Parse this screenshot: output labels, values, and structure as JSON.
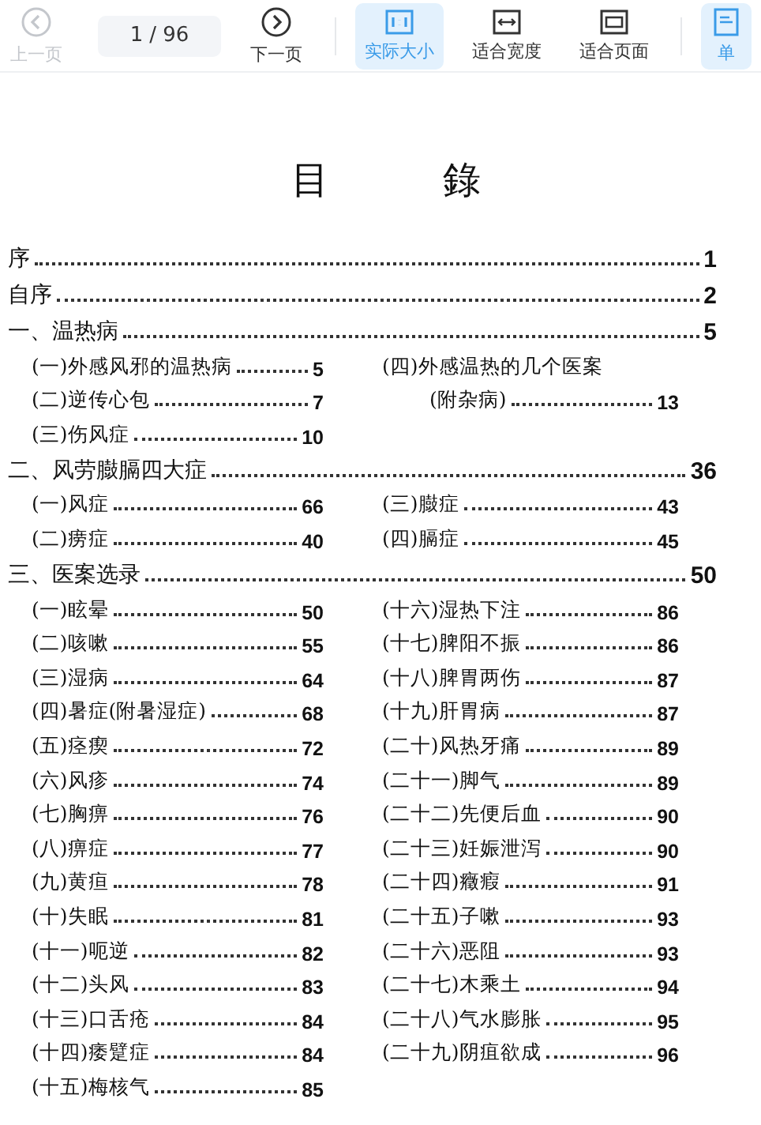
{
  "toolbar": {
    "items": [
      {
        "kind": "prev",
        "label": "上一页",
        "disabled": true,
        "selected": false
      },
      {
        "kind": "page",
        "value": "1",
        "total": "/ 96"
      },
      {
        "kind": "next",
        "label": "下一页",
        "disabled": false,
        "selected": false
      },
      {
        "kind": "separator"
      },
      {
        "kind": "actual-size",
        "label": "实际大小",
        "disabled": false,
        "selected": true
      },
      {
        "kind": "fit-width",
        "label": "适合宽度",
        "disabled": false,
        "selected": false
      },
      {
        "kind": "fit-page",
        "label": "适合页面",
        "disabled": false,
        "selected": false
      },
      {
        "kind": "separator"
      },
      {
        "kind": "single-page",
        "label": "单",
        "disabled": false,
        "selected": true
      }
    ]
  },
  "document": {
    "title": "目　　　錄",
    "entries": [
      {
        "kind": "main",
        "label": "序",
        "page": "1"
      },
      {
        "kind": "main",
        "label": "自序",
        "page": "2"
      },
      {
        "kind": "main",
        "label": "一、温热病",
        "page": "5"
      },
      {
        "kind": "pair",
        "left": {
          "label": "(一)外感风邪的温热病",
          "page": "5"
        },
        "right": {
          "label": "(四)外感温热的几个医案",
          "wrapped": false
        }
      },
      {
        "kind": "pair",
        "left": {
          "label": "(二)逆传心包",
          "page": "7"
        },
        "right": {
          "label": "(附杂病)",
          "page": "13",
          "wrapped": true
        }
      },
      {
        "kind": "pair",
        "left": {
          "label": "(三)伤风症",
          "page": "10"
        }
      },
      {
        "kind": "main",
        "label": "二、风劳臌膈四大症",
        "page": "36"
      },
      {
        "kind": "pair",
        "left": {
          "label": "(一)风症",
          "page": "66"
        },
        "right": {
          "label": "(三)臌症",
          "page": "43",
          "wrapped": false
        }
      },
      {
        "kind": "pair",
        "left": {
          "label": "(二)痨症",
          "page": "40"
        },
        "right": {
          "label": "(四)膈症",
          "page": "45",
          "wrapped": false
        }
      },
      {
        "kind": "main",
        "label": "三、医案选录",
        "page": "50"
      },
      {
        "kind": "pair",
        "left": {
          "label": "(一)眩晕",
          "page": "50"
        },
        "right": {
          "label": "(十六)湿热下注",
          "page": "86",
          "wrapped": false
        }
      },
      {
        "kind": "pair",
        "left": {
          "label": "(二)咳嗽",
          "page": "55"
        },
        "right": {
          "label": "(十七)脾阳不振",
          "page": "86",
          "wrapped": false
        }
      },
      {
        "kind": "pair",
        "left": {
          "label": "(三)湿病",
          "page": "64"
        },
        "right": {
          "label": "(十八)脾胃两伤",
          "page": "87",
          "wrapped": false
        }
      },
      {
        "kind": "pair",
        "left": {
          "label": "(四)暑症(附暑湿症)",
          "page": "68"
        },
        "right": {
          "label": "(十九)肝胃病",
          "page": "87",
          "wrapped": false
        }
      },
      {
        "kind": "pair",
        "left": {
          "label": "(五)痉瘈",
          "page": "72"
        },
        "right": {
          "label": "(二十)风热牙痛",
          "page": "89",
          "wrapped": false
        }
      },
      {
        "kind": "pair",
        "left": {
          "label": "(六)风疹",
          "page": "74"
        },
        "right": {
          "label": "(二十一)脚气",
          "page": "89",
          "wrapped": false
        }
      },
      {
        "kind": "pair",
        "left": {
          "label": "(七)胸痹",
          "page": "76"
        },
        "right": {
          "label": "(二十二)先便后血",
          "page": "90",
          "wrapped": false
        }
      },
      {
        "kind": "pair",
        "left": {
          "label": "(八)痹症",
          "page": "77"
        },
        "right": {
          "label": "(二十三)妊娠泄泻",
          "page": "90",
          "wrapped": false
        }
      },
      {
        "kind": "pair",
        "left": {
          "label": "(九)黄疸",
          "page": "78"
        },
        "right": {
          "label": "(二十四)癥瘕",
          "page": "91",
          "wrapped": false
        }
      },
      {
        "kind": "pair",
        "left": {
          "label": "(十)失眠",
          "page": "81"
        },
        "right": {
          "label": "(二十五)子嗽",
          "page": "93",
          "wrapped": false
        }
      },
      {
        "kind": "pair",
        "left": {
          "label": "(十一)呃逆",
          "page": "82"
        },
        "right": {
          "label": "(二十六)恶阻",
          "page": "93",
          "wrapped": false
        }
      },
      {
        "kind": "pair",
        "left": {
          "label": "(十二)头风",
          "page": "83"
        },
        "right": {
          "label": "(二十七)木乘土",
          "page": "94",
          "wrapped": false
        }
      },
      {
        "kind": "pair",
        "left": {
          "label": "(十三)口舌疮",
          "page": "84"
        },
        "right": {
          "label": "(二十八)气水膨胀",
          "page": "95",
          "wrapped": false
        }
      },
      {
        "kind": "pair",
        "left": {
          "label": "(十四)痿躄症",
          "page": "84"
        },
        "right": {
          "label": "(二十九)阴疽欲成",
          "page": "96",
          "wrapped": false
        }
      },
      {
        "kind": "pair",
        "left": {
          "label": "(十五)梅核气",
          "page": "85"
        }
      }
    ]
  }
}
